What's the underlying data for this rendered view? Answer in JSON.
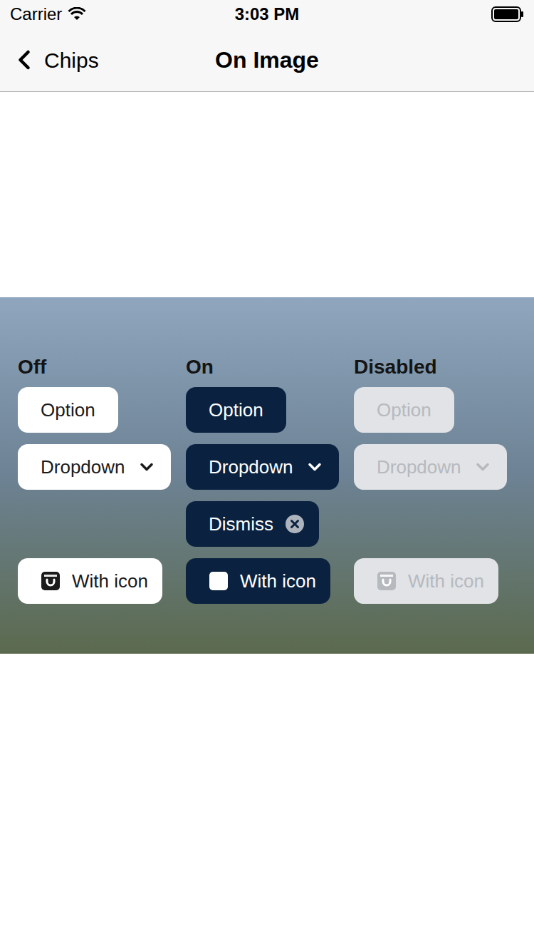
{
  "status_bar": {
    "carrier": "Carrier",
    "time": "3:03 PM"
  },
  "nav_bar": {
    "back": "Chips",
    "title": "On Image"
  },
  "columns": [
    {
      "label": "Off",
      "selected": false,
      "disabled": false
    },
    {
      "label": "On",
      "selected": true,
      "disabled": false
    },
    {
      "label": "Disabled",
      "selected": false,
      "disabled": true
    }
  ],
  "rows": [
    {
      "kind": "option",
      "chips": [
        {
          "label": "Option",
          "selected": false,
          "disabled": false
        },
        {
          "label": "Option",
          "selected": true,
          "disabled": false
        },
        {
          "label": "Option",
          "selected": false,
          "disabled": true
        }
      ]
    },
    {
      "kind": "dropdown",
      "chips": [
        {
          "label": "Dropdown",
          "selected": false,
          "disabled": false
        },
        {
          "label": "Dropdown",
          "selected": true,
          "disabled": false
        },
        {
          "label": "Dropdown",
          "selected": false,
          "disabled": true
        }
      ]
    },
    {
      "kind": "dismiss",
      "chips": [
        {
          "label": "Dismiss",
          "selected": true,
          "disabled": false
        }
      ]
    },
    {
      "kind": "icon",
      "chips": [
        {
          "label": "With icon",
          "selected": false,
          "disabled": false
        },
        {
          "label": "With icon",
          "selected": true,
          "disabled": false
        },
        {
          "label": "With icon",
          "selected": false,
          "disabled": true
        }
      ]
    }
  ]
}
